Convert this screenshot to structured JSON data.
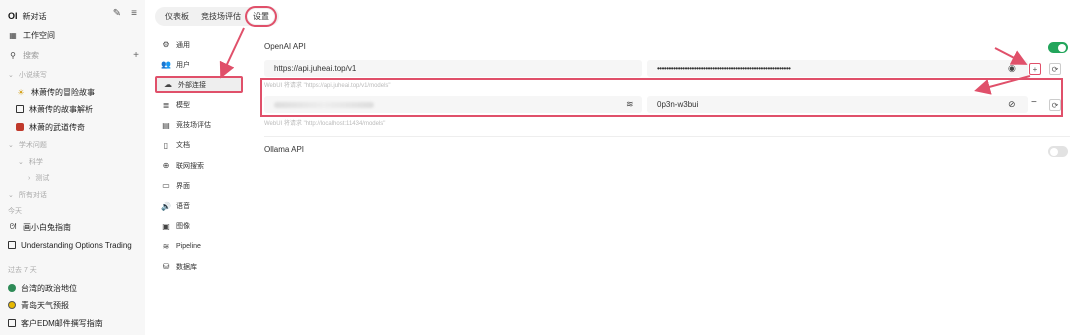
{
  "sidebar": {
    "logo": "OI",
    "new_chat": "新对话",
    "workspace": "工作空间",
    "search_placeholder": "搜索",
    "folders": [
      {
        "label": "小说续写",
        "items": [
          "林萧传的冒险故事",
          "林萧传的故事解析",
          "林萧的武道传奇"
        ]
      },
      {
        "label": "学术问题",
        "sub": "科学",
        "subsub": "测试"
      }
    ],
    "all_chats": "所有对话",
    "today": "今天",
    "today_items": [
      "画小白兔指南",
      "Understanding Options Trading"
    ],
    "past7": "过去 7 天",
    "past_items": [
      "台湾的政治地位",
      "青岛天气预报",
      "客户EDM邮件撰写指南"
    ]
  },
  "tabs": [
    "仪表板",
    "竞技场评估",
    "设置"
  ],
  "nav": [
    "通用",
    "用户",
    "外部连接",
    "模型",
    "竞技场评估",
    "文档",
    "联网搜索",
    "界面",
    "语音",
    "图像",
    "Pipeline",
    "数据库"
  ],
  "openai": {
    "title": "OpenAI API",
    "url": "https://api.juheai.top/v1",
    "key_masked": "••••••••••••••••••••••••••••••••••••••••••••••••••••••••••",
    "hint1": "WebUI 将请求 \"https://api.juheai.top/v1/models\"",
    "key2": "0p3n-w3bui",
    "hint2": "WebUI 将请求 \"http://localhost:11434/models\""
  },
  "ollama": {
    "title": "Ollama API"
  },
  "colors": {
    "accent": "#e0506a",
    "toggle_on": "#22a55b",
    "toggle_off": "#e2e2e2"
  }
}
